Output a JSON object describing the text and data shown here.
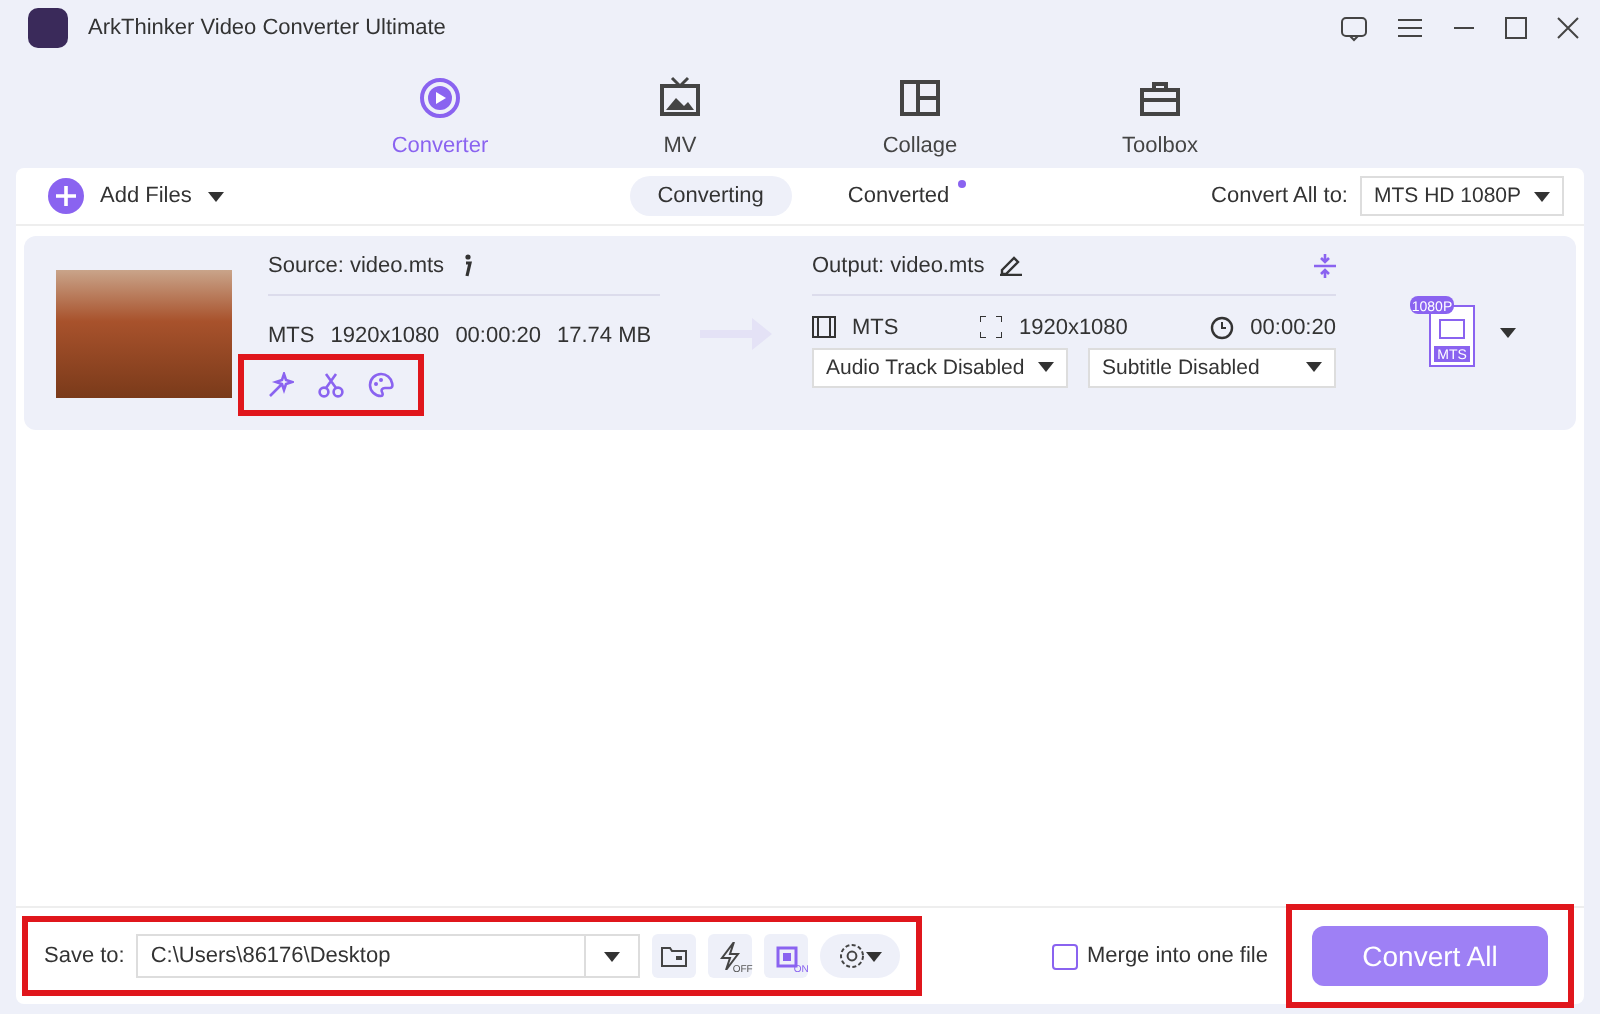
{
  "window": {
    "title": "ArkThinker Video Converter Ultimate"
  },
  "nav": [
    {
      "label": "Converter",
      "selected": true,
      "kind": "converter"
    },
    {
      "label": "MV",
      "selected": false,
      "kind": "mv"
    },
    {
      "label": "Collage",
      "selected": false,
      "kind": "collage"
    },
    {
      "label": "Toolbox",
      "selected": false,
      "kind": "toolbox"
    }
  ],
  "toolbar": {
    "add_files": "Add Files",
    "tabs": [
      {
        "label": "Converting",
        "selected": true,
        "new_dot": false
      },
      {
        "label": "Converted",
        "selected": false,
        "new_dot": true
      }
    ],
    "convert_all_label": "Convert All to:",
    "convert_all_value": "MTS HD 1080P"
  },
  "file": {
    "source": "Source: video.mts",
    "meta": [
      "MTS",
      "1920x1080",
      "00:00:20",
      "17.74 MB"
    ],
    "tools_highlighted": true,
    "output": "Output: video.mts",
    "format": "MTS",
    "resolution": "1920x1080",
    "duration": "00:00:20",
    "audio": "Audio Track Disabled",
    "subtitle": "Subtitle Disabled",
    "badge_top": "1080P",
    "badge_bottom": "MTS"
  },
  "save_bar": {
    "label": "Save to:",
    "path": "C:\\Users\\86176\\Desktop",
    "accel_state": "OFF",
    "gpu_state": "ON",
    "highlighted": true
  },
  "merge": {
    "label": "Merge into one file",
    "checked": false
  },
  "convert_button": {
    "label": "Convert All",
    "highlighted": true
  }
}
